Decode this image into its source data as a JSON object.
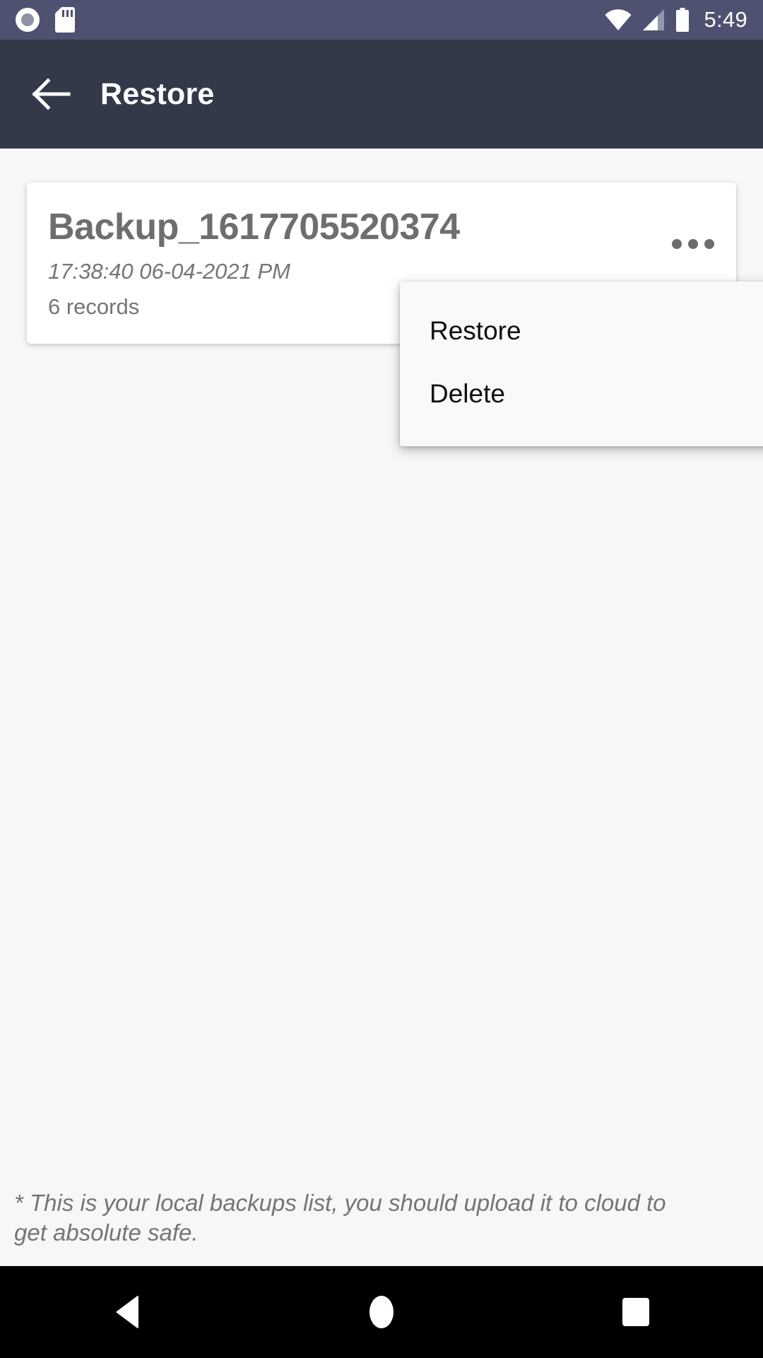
{
  "status_bar": {
    "time": "5:49",
    "icons": {
      "record": "record-icon",
      "sdcard": "sd-card-icon",
      "wifi": "wifi-icon",
      "signal": "cellular-signal-icon",
      "battery": "battery-full-icon"
    },
    "background_color": "#4e5270"
  },
  "app_bar": {
    "title": "Restore",
    "back_icon": "back-arrow-icon",
    "background_color": "#343949",
    "title_color": "#ffffff"
  },
  "backup_card": {
    "title": "Backup_1617705520374",
    "date": "17:38:40 06-04-2021 PM",
    "records": "6 records",
    "overflow_icon": "overflow-menu-icon",
    "background_color": "#ffffff",
    "title_color": "#6e6e6e"
  },
  "popup_menu": {
    "items": [
      {
        "label": "Restore"
      },
      {
        "label": "Delete"
      }
    ],
    "background_color": "#f9f9f9"
  },
  "footer": {
    "note": "* This is your local backups list, you should upload it to cloud to get absolute safe.",
    "color": "#757575"
  },
  "nav_bar": {
    "back": "nav-back-icon",
    "home": "nav-home-icon",
    "recents": "nav-recents-icon",
    "background_color": "#000000"
  }
}
